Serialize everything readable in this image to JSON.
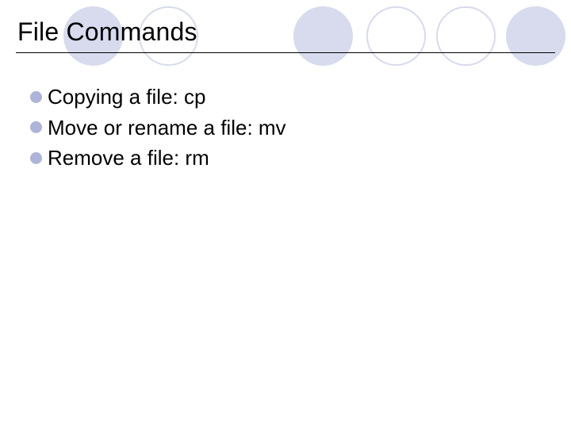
{
  "title": "File Commands",
  "bullets": {
    "items": [
      {
        "text": "Copying a file: cp"
      },
      {
        "text": "Move or rename a file: mv"
      },
      {
        "text": "Remove a file: rm"
      }
    ]
  }
}
